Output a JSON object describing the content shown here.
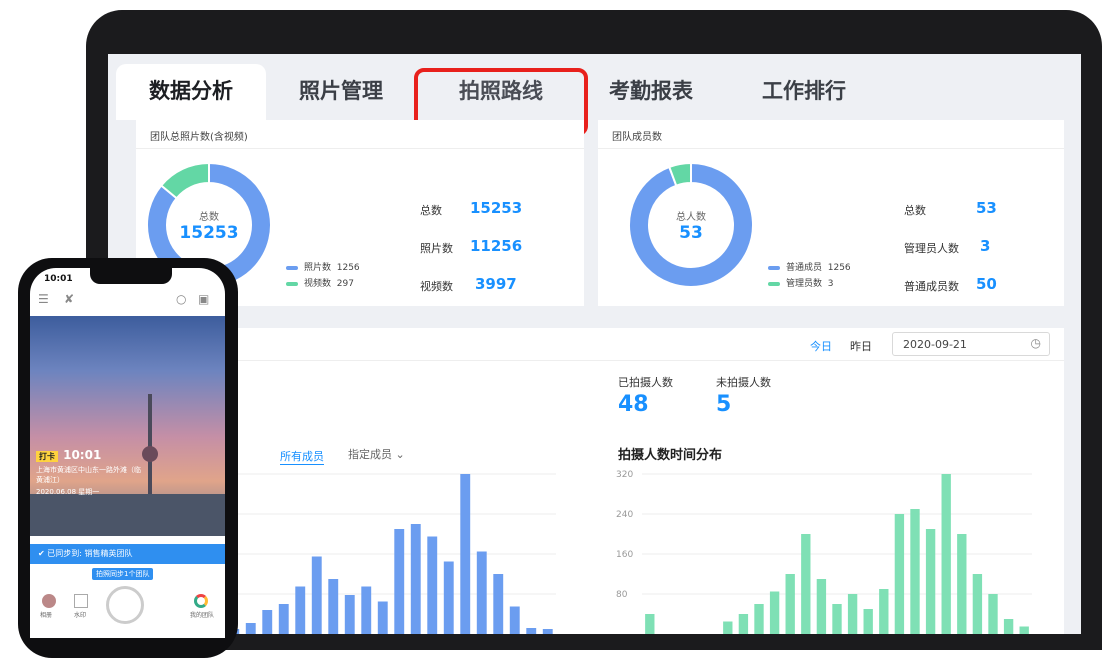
{
  "tabs": [
    "数据分析",
    "照片管理",
    "拍照路线",
    "考勤报表",
    "工作排行"
  ],
  "photos_panel": {
    "title": "团队总照片数(含视频)",
    "center_label": "总数",
    "center_value": "15253",
    "legend": [
      {
        "label": "照片数",
        "value": "1256",
        "color": "#6b9df0"
      },
      {
        "label": "视频数",
        "value": "297",
        "color": "#63d7a5"
      }
    ],
    "stats": [
      {
        "label": "总数",
        "value": "15253"
      },
      {
        "label": "照片数",
        "value": "11256"
      },
      {
        "label": "视频数",
        "value": "3997"
      }
    ],
    "donut_shares": [
      0.86,
      0.14
    ]
  },
  "members_panel": {
    "title": "团队成员数",
    "center_label": "总人数",
    "center_value": "53",
    "legend": [
      {
        "label": "普通成员",
        "value": "1256",
        "color": "#6b9df0"
      },
      {
        "label": "管理员数",
        "value": "3",
        "color": "#63d7a5"
      }
    ],
    "stats": [
      {
        "label": "总数",
        "value": "53"
      },
      {
        "label": "管理员人数",
        "value": "3"
      },
      {
        "label": "普通成员数",
        "value": "50"
      }
    ],
    "donut_shares": [
      0.943,
      0.057
    ]
  },
  "date_bar": {
    "today": "今日",
    "yesterday": "昨日",
    "date": "2020-09-21"
  },
  "shoot_stats": {
    "shot_label": "已拍摄人数",
    "shot_value": "48",
    "not_shot_label": "未拍摄人数",
    "not_shot_value": "5"
  },
  "filters": {
    "all": "所有成员",
    "specified": "指定成员"
  },
  "chart_data": [
    {
      "type": "bar",
      "title": "",
      "color": "#6b9df0",
      "values": [
        10,
        22,
        48,
        60,
        95,
        155,
        110,
        78,
        95,
        65,
        210,
        220,
        195,
        145,
        320,
        165,
        120,
        55,
        12,
        10
      ],
      "ylim": [
        0,
        320
      ]
    },
    {
      "type": "bar",
      "title": "拍摄人数时间分布",
      "color": "#7fe0b5",
      "yticks": [
        "320",
        "240",
        "160",
        "80"
      ],
      "values": [
        40,
        0,
        0,
        0,
        0,
        25,
        40,
        60,
        85,
        120,
        200,
        110,
        60,
        80,
        50,
        90,
        240,
        250,
        210,
        320,
        200,
        120,
        80,
        30,
        15
      ],
      "ylim": [
        0,
        320
      ]
    }
  ],
  "phone": {
    "time": "10:01",
    "stamp_tag": "打卡",
    "stamp_time": "10:01",
    "stamp_address": "上海市黄浦区中山东一路外滩（临黄浦江）",
    "stamp_date": "2020.06.08 星期一",
    "synced": "已同步到: 销售精英团队",
    "sync_btn": "拍照同步1个团队",
    "nav_left": "相册",
    "nav_mid": "水印",
    "nav_right": "我的团队"
  }
}
